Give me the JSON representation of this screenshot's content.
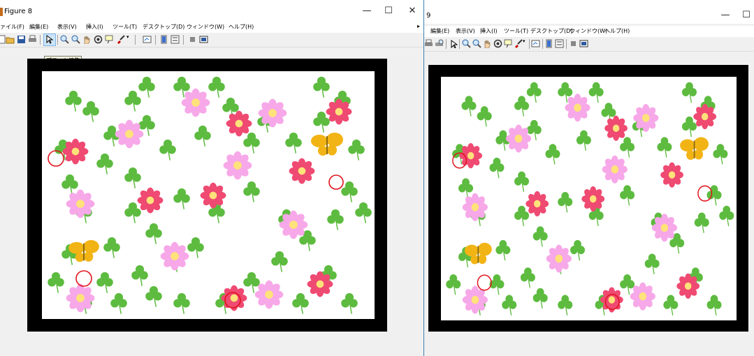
{
  "window1": {
    "title": "Figure 8",
    "controls": {
      "minimize": "—",
      "maximize": "☐",
      "close": "✕"
    },
    "menu": [
      "ァイル(F)",
      "編集(E)",
      "表示(V)",
      "挿入(I)",
      "ツール(T)",
      "デスクトップ(D)",
      "ウィンドウ(W)",
      "ヘルプ(H)"
    ],
    "menu_more": "▸",
    "tooltip": "プロット編集"
  },
  "window2": {
    "title": "9",
    "controls": {
      "minimize": "—",
      "maximize": "☐"
    },
    "menu": [
      "編集(E)",
      "表示(V)",
      "挿入(I)",
      "ツール(T)",
      "デスクトップ(D)",
      "ウィンドウ(W)",
      "ヘルプ(H)"
    ]
  },
  "toolbar_icons": [
    "new-figure-icon",
    "open-file-icon",
    "save-icon",
    "print-icon",
    "edit-plot-icon",
    "zoom-in-icon",
    "zoom-out-icon",
    "pan-icon",
    "rotate-3d-icon",
    "data-cursor-icon",
    "brush-icon",
    "link-plot-icon",
    "colorbar-icon",
    "legend-icon",
    "hide-plot-tools-icon",
    "show-plot-tools-icon"
  ],
  "colors": {
    "background": "#f0f0f0",
    "frame": "#000000",
    "clover_green": "#5dbb3f",
    "pink_flower": "#f7a8e8",
    "red_flower": "#ef4a72",
    "butterfly": "#f2b415",
    "flower_center": "#ffe27a",
    "marker_circle": "#e0121a"
  }
}
